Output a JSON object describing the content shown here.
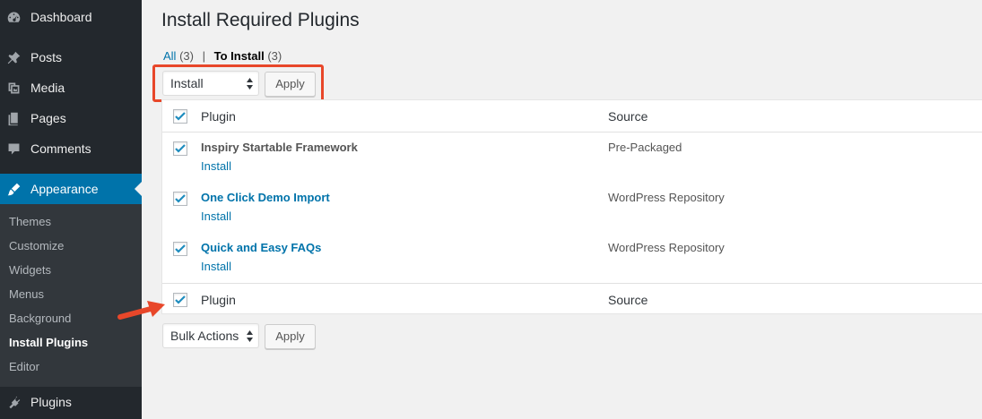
{
  "sidebar": {
    "items": [
      {
        "label": "Dashboard",
        "icon": "dashboard-icon"
      },
      {
        "label": "Posts",
        "icon": "pin-icon"
      },
      {
        "label": "Media",
        "icon": "media-icon"
      },
      {
        "label": "Pages",
        "icon": "pages-icon"
      },
      {
        "label": "Comments",
        "icon": "comment-icon"
      },
      {
        "label": "Appearance",
        "icon": "brush-icon"
      },
      {
        "label": "Plugins",
        "icon": "plug-icon"
      }
    ],
    "submenu": [
      "Themes",
      "Customize",
      "Widgets",
      "Menus",
      "Background",
      "Install Plugins",
      "Editor"
    ]
  },
  "page": {
    "title": "Install Required Plugins",
    "filters": {
      "all_label": "All",
      "all_count": "(3)",
      "separator": "|",
      "to_install_label": "To Install",
      "to_install_count": "(3)"
    }
  },
  "top_actions": {
    "select_value": "Install",
    "apply_label": "Apply"
  },
  "bottom_actions": {
    "select_value": "Bulk Actions",
    "apply_label": "Apply"
  },
  "table": {
    "header": {
      "plugin": "Plugin",
      "source": "Source"
    },
    "footer": {
      "plugin": "Plugin",
      "source": "Source"
    },
    "rows": [
      {
        "name": "Inspiry Startable Framework",
        "action": "Install",
        "source": "Pre-Packaged"
      },
      {
        "name": "One Click Demo Import",
        "action": "Install",
        "source": "WordPress Repository"
      },
      {
        "name": "Quick and Easy FAQs",
        "action": "Install",
        "source": "WordPress Repository"
      }
    ]
  },
  "colors": {
    "sidebar_bg": "#23282d",
    "active_bg": "#0073aa",
    "link": "#0073aa",
    "highlight": "#e8472a"
  }
}
